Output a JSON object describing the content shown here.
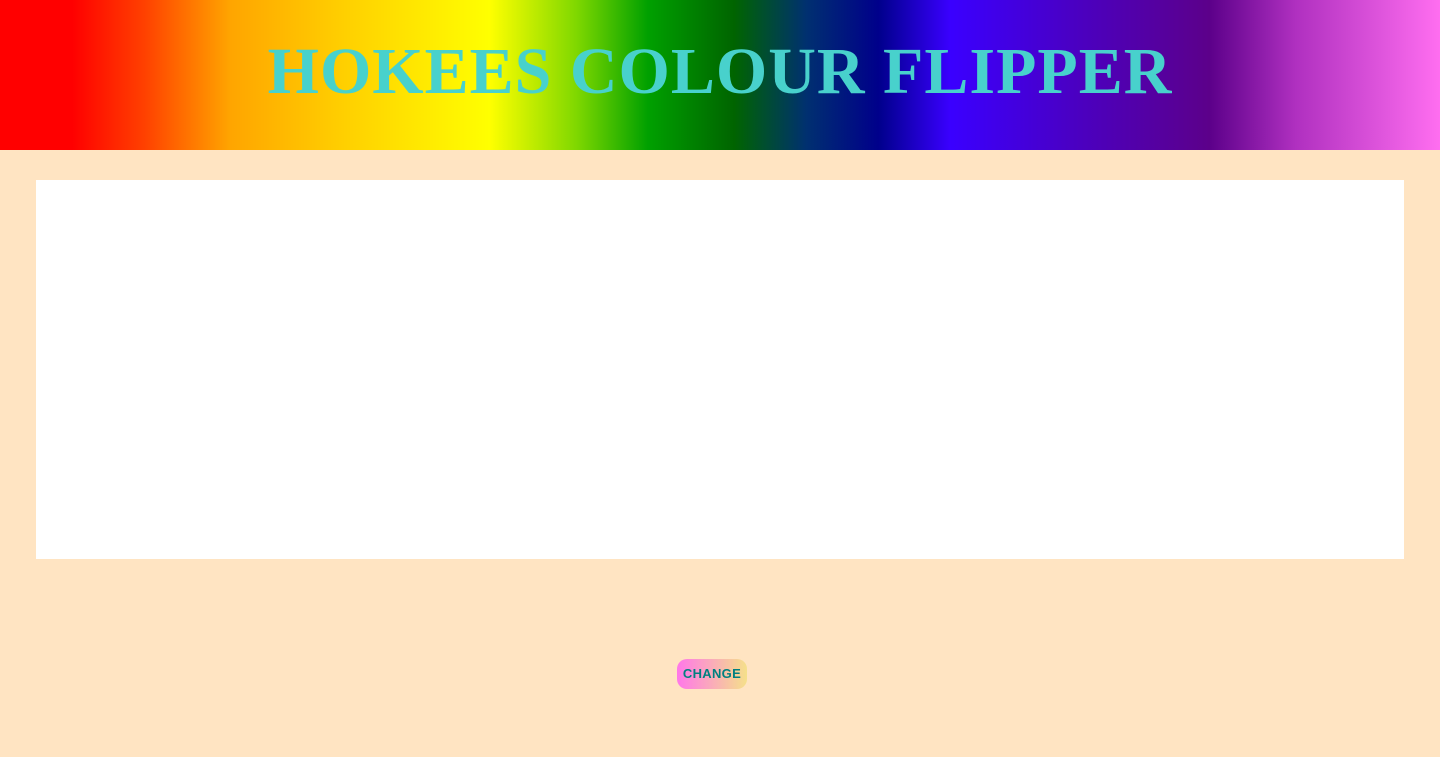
{
  "header": {
    "title": "HOKEES COLOUR FLIPPER"
  },
  "color_box": {
    "current_color": "#ffffff"
  },
  "controls": {
    "change_label": "CHANGE"
  },
  "colors": {
    "background": "#ffe4c2",
    "title": "#48d1cc",
    "button_text": "#008080",
    "button_gradient_start": "#ff77e9",
    "button_gradient_end": "#f5e08a"
  }
}
